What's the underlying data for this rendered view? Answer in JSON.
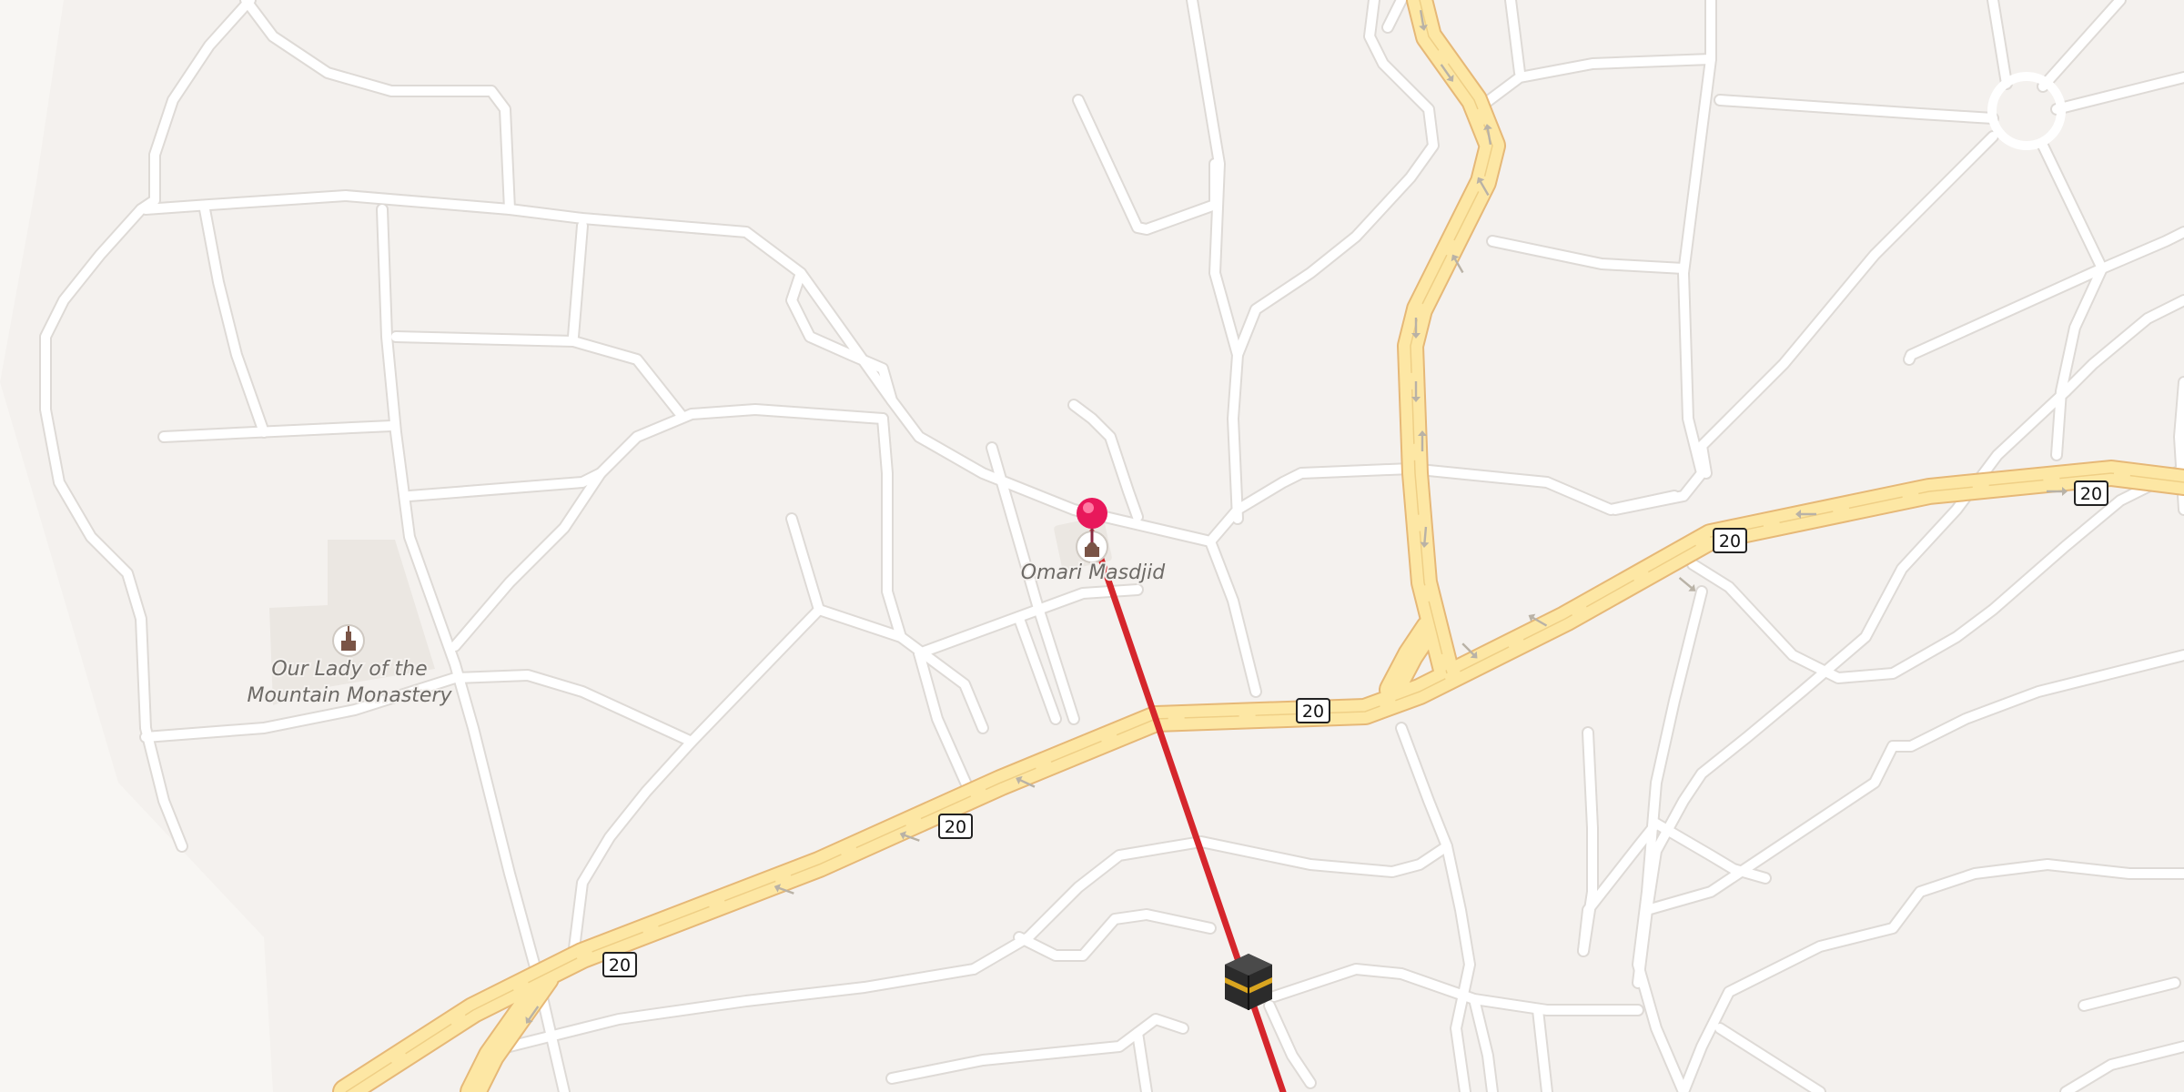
{
  "map": {
    "route_shield": "20",
    "colors": {
      "background": "#f4f1ee",
      "minor_road": "#ffffff",
      "highway_fill": "#fde7a4",
      "highway_casing": "#e6b877",
      "route_line": "#d5262c",
      "pin": "#e8185b"
    }
  },
  "pois": [
    {
      "name": "Our Lady of the Mountain Monastery",
      "label_lines": [
        "Our Lady of the",
        "Mountain Monastery"
      ],
      "icon": "place-of-worship-icon"
    },
    {
      "name": "Omari Masdjid",
      "label_lines": [
        "Omari Masdjid"
      ],
      "icon": "mosque-icon"
    }
  ],
  "markers": {
    "selected_pin": "location-pin-icon",
    "destination": "kaaba-icon"
  }
}
